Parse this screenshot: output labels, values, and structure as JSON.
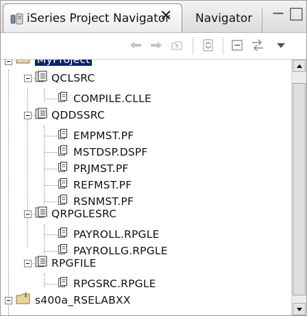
{
  "tabs": {
    "active_label": "iSeries Project Navigator",
    "inactive_label": "Navigator",
    "close_glyph": "✕"
  },
  "window_controls": {
    "minimize": "−",
    "maximize": "□"
  },
  "toolbar": {
    "buttons": [
      "back",
      "forward",
      "up",
      "link-with-editor",
      "collapse-all",
      "sync",
      "view-menu"
    ]
  },
  "tree": {
    "root": "MyProject",
    "items": [
      {
        "label": "QCLSRC"
      },
      {
        "label": "COMPILE.CLLE"
      },
      {
        "label": "QDDSSRC"
      },
      {
        "label": "EMPMST.PF"
      },
      {
        "label": "MSTDSP.DSPF"
      },
      {
        "label": "PRJMST.PF"
      },
      {
        "label": "REFMST.PF"
      },
      {
        "label": "RSNMST.PF"
      },
      {
        "label": "QRPGLESRC"
      },
      {
        "label": "PAYROLL.RPGLE"
      },
      {
        "label": "PAYROLLG.RPGLE"
      },
      {
        "label": "RPGFILE"
      },
      {
        "label": "RPGSRC.RPGLE"
      }
    ],
    "second_project": "s400a_RSELABXX"
  },
  "colors": {
    "selection": "#0a246a",
    "tree_line": "#8a8a8a"
  }
}
